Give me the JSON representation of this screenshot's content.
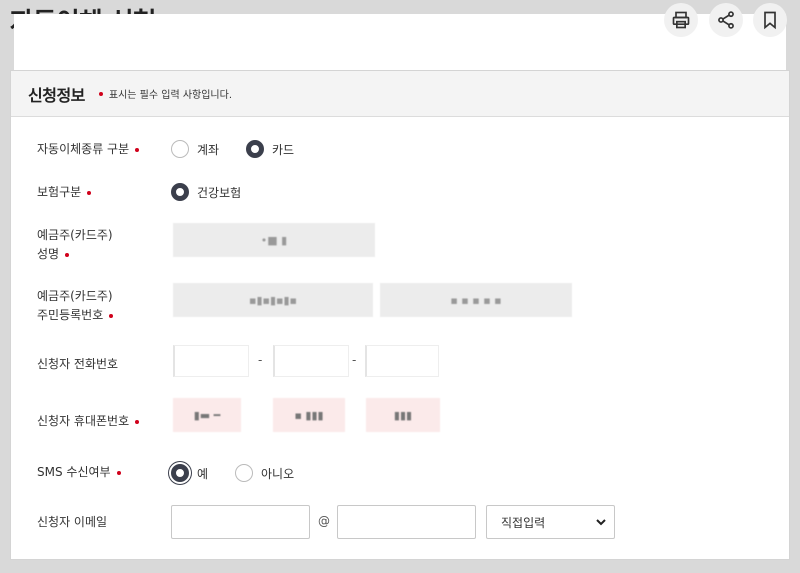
{
  "page": {
    "title": "자동이체 신청",
    "toolbar": {
      "print_icon": "print-icon",
      "share_icon": "share-icon",
      "bookmark_icon": "bookmark-icon"
    }
  },
  "section": {
    "title": "신청정보",
    "required_note": "표시는 필수 입력 사항입니다."
  },
  "form": {
    "autopay_type": {
      "label": "자동이체종류 구분",
      "options": [
        "계좌",
        "카드"
      ],
      "selected": "카드"
    },
    "insurance_type": {
      "label": "보험구분",
      "options": [
        "건강보험"
      ],
      "selected": "건강보험"
    },
    "depositor_name": {
      "label_line1": "예금주(카드주)",
      "label_line2": "성명",
      "value": "•■ ▮"
    },
    "depositor_id": {
      "label_line1": "예금주(카드주)",
      "label_line2": "주민등록번호",
      "value1": "▪▮▪▮▪▮▪",
      "value2": "▪ ▪ ▪ ▪ ▪"
    },
    "applicant_phone": {
      "label": "신청자 전화번호",
      "separator": "-"
    },
    "applicant_mobile": {
      "label": "신청자 휴대폰번호",
      "part1": "▮▬ ━",
      "part2": "▪ ▮▮▮",
      "part3": "▮▮▮"
    },
    "sms": {
      "label": "SMS 수신여부",
      "options": [
        "예",
        "아니오"
      ],
      "selected": "예"
    },
    "email": {
      "label": "신청자 이메일",
      "at": "@",
      "domain_select": "직접입력"
    }
  },
  "colors": {
    "accent_dark": "#3b3f4c",
    "required_dot": "#d0011b",
    "pink_field": "#fbeaea"
  }
}
